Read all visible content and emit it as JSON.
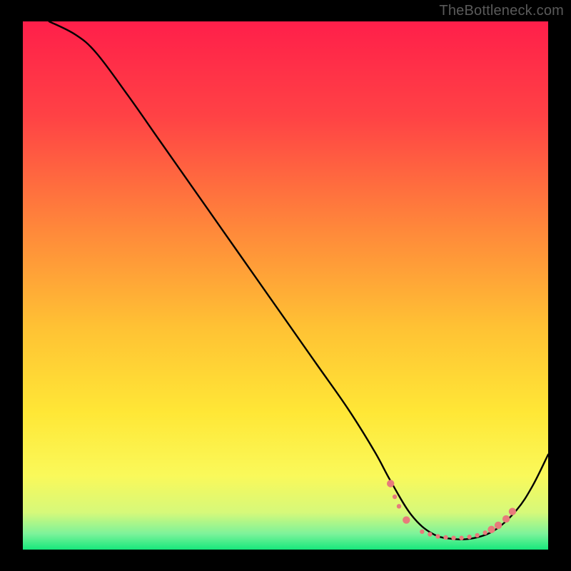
{
  "watermark": "TheBottleneck.com",
  "chart_data": {
    "type": "line",
    "title": "",
    "xlabel": "",
    "ylabel": "",
    "xlim": [
      0,
      100
    ],
    "ylim": [
      0,
      100
    ],
    "gradient_stops": [
      {
        "offset": 0,
        "color": "#ff1f4a"
      },
      {
        "offset": 18,
        "color": "#ff4245"
      },
      {
        "offset": 40,
        "color": "#ff8a3a"
      },
      {
        "offset": 58,
        "color": "#ffc234"
      },
      {
        "offset": 74,
        "color": "#ffe736"
      },
      {
        "offset": 86,
        "color": "#faf95a"
      },
      {
        "offset": 93,
        "color": "#d6f97a"
      },
      {
        "offset": 97,
        "color": "#7df39a"
      },
      {
        "offset": 100,
        "color": "#17e87c"
      }
    ],
    "series": [
      {
        "name": "curve",
        "color": "#000000",
        "x": [
          5,
          10,
          14,
          20,
          26,
          32,
          38,
          44,
          50,
          56,
          62,
          67,
          70,
          74,
          78,
          82,
          86,
          90,
          94,
          97,
          100
        ],
        "y": [
          100,
          97.5,
          94,
          86,
          77.5,
          69,
          60.5,
          52,
          43.5,
          35,
          26.5,
          18.5,
          13,
          6.5,
          3,
          2,
          2.2,
          3.8,
          7.5,
          12,
          18
        ]
      }
    ],
    "markers": {
      "name": "highlight-dots",
      "color": "#e77b7b",
      "radius_large": 5.2,
      "radius_small": 3.2,
      "points": [
        {
          "x": 70.0,
          "y": 12.5,
          "r": "large"
        },
        {
          "x": 70.8,
          "y": 10.0,
          "r": "small"
        },
        {
          "x": 71.6,
          "y": 8.2,
          "r": "small"
        },
        {
          "x": 73.0,
          "y": 5.6,
          "r": "large"
        },
        {
          "x": 76.0,
          "y": 3.4,
          "r": "small"
        },
        {
          "x": 77.5,
          "y": 2.9,
          "r": "small"
        },
        {
          "x": 79.0,
          "y": 2.5,
          "r": "small"
        },
        {
          "x": 80.5,
          "y": 2.3,
          "r": "small"
        },
        {
          "x": 82.0,
          "y": 2.2,
          "r": "small"
        },
        {
          "x": 83.5,
          "y": 2.2,
          "r": "small"
        },
        {
          "x": 85.0,
          "y": 2.4,
          "r": "small"
        },
        {
          "x": 86.5,
          "y": 2.7,
          "r": "small"
        },
        {
          "x": 88.0,
          "y": 3.2,
          "r": "small"
        },
        {
          "x": 89.2,
          "y": 3.8,
          "r": "large"
        },
        {
          "x": 90.5,
          "y": 4.6,
          "r": "large"
        },
        {
          "x": 92.0,
          "y": 5.8,
          "r": "large"
        },
        {
          "x": 93.2,
          "y": 7.2,
          "r": "large"
        }
      ]
    }
  }
}
